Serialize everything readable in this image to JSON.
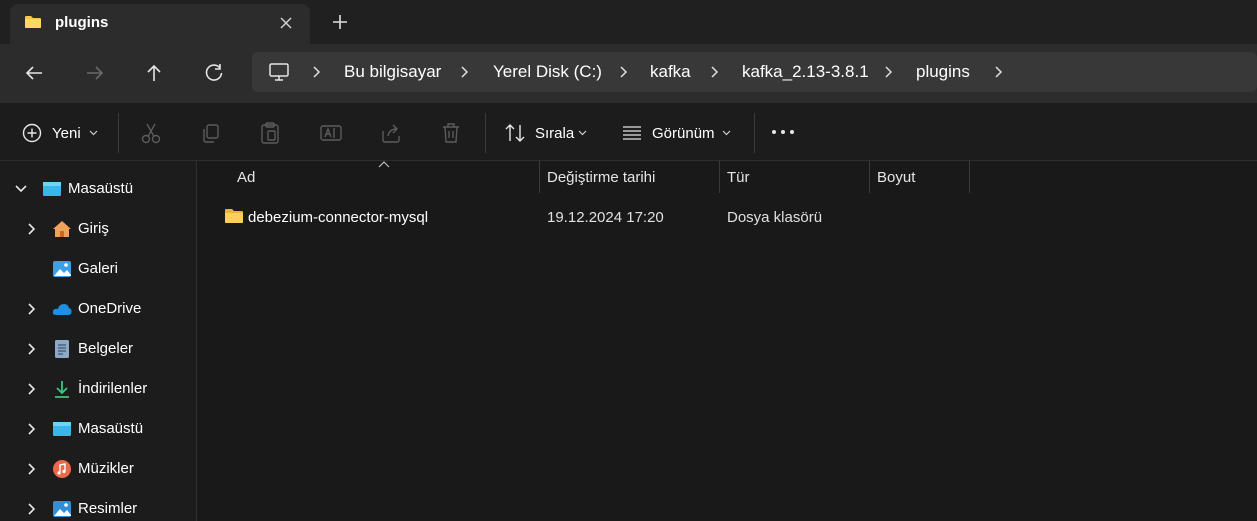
{
  "tab": {
    "title": "plugins"
  },
  "breadcrumb": {
    "items": [
      "Bu bilgisayar",
      "Yerel Disk (C:)",
      "kafka",
      "kafka_2.13-3.8.1",
      "plugins"
    ]
  },
  "toolbar": {
    "new_label": "Yeni",
    "sort_label": "Sırala",
    "view_label": "Görünüm"
  },
  "sidebar": {
    "items": [
      {
        "label": "Masaüstü",
        "icon": "desktop-icon",
        "expanded": true
      },
      {
        "label": "Giriş",
        "icon": "home-icon"
      },
      {
        "label": "Galeri",
        "icon": "gallery-icon"
      },
      {
        "label": "OneDrive",
        "icon": "onedrive-icon"
      },
      {
        "label": "Belgeler",
        "icon": "documents-icon"
      },
      {
        "label": "İndirilenler",
        "icon": "downloads-icon"
      },
      {
        "label": "Masaüstü",
        "icon": "desktop-icon"
      },
      {
        "label": "Müzikler",
        "icon": "music-icon"
      },
      {
        "label": "Resimler",
        "icon": "pictures-icon"
      }
    ]
  },
  "columns": {
    "name": "Ad",
    "modified": "Değiştirme tarihi",
    "type": "Tür",
    "size": "Boyut"
  },
  "files": [
    {
      "name": "debezium-connector-mysql",
      "modified": "19.12.2024 17:20",
      "type": "Dosya klasörü",
      "size": ""
    }
  ],
  "colors": {
    "folder": "#f6c54a",
    "accent": "#4cc2ff",
    "background": "#191919"
  }
}
